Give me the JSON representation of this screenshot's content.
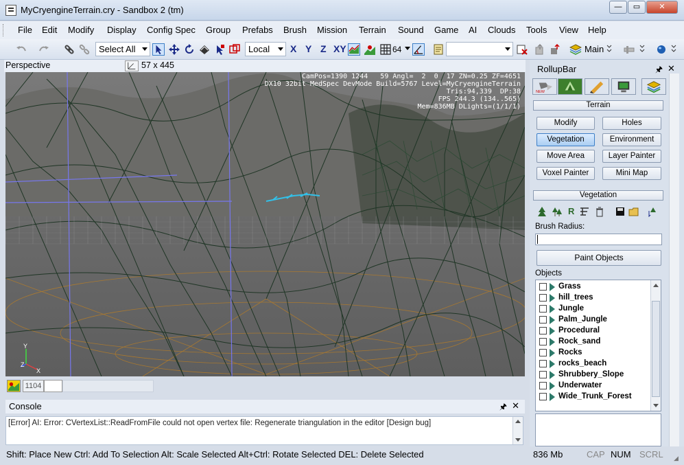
{
  "window": {
    "title": "MyCryengineTerrain.cry - Sandbox 2 (tm)",
    "min_label": "—",
    "max_label": "▭",
    "close_label": "✕"
  },
  "menu": [
    "File",
    "Edit",
    "Modify",
    "Display",
    "Config Spec",
    "Group",
    "Prefabs",
    "Brush",
    "Mission",
    "Terrain",
    "Sound",
    "Game",
    "AI",
    "Clouds",
    "Tools",
    "View",
    "Help"
  ],
  "toolbar": {
    "selection_combo": "Select All",
    "coord_combo": "Local",
    "axes": [
      "X",
      "Y",
      "Z",
      "XY"
    ],
    "grid_value": "64",
    "layout_label": "Main",
    "layer_combo": ""
  },
  "viewport": {
    "name": "Perspective",
    "size": "57 x 445",
    "overlay": [
      "CamPos=1390 1244   59 Angl=  2  0  17 ZN=0.25 ZF=4651",
      "DX10 32bit MedSpec DevMode Build=5767 Level=MyCryengineTerrain",
      "Tris:94,339  DP:38",
      "FPS 244.3 (134..565)",
      "Mem=836MB DLights=(1/1/1)"
    ],
    "axis_labels": [
      "Y",
      "Z",
      "X"
    ],
    "status_value": "1104"
  },
  "console": {
    "title": "Console",
    "message": "[Error] AI: Error: CVertexList::ReadFromFile could not open vertex file: Regenerate triangulation in the editor [Design bug]"
  },
  "statusbar": {
    "hint": "Shift: Place New  Ctrl: Add To Selection  Alt: Scale Selected  Alt+Ctrl: Rotate Selected DEL: Delete Selected",
    "memory": "836 Mb",
    "cap": "CAP",
    "num": "NUM",
    "scrl": "SCRL"
  },
  "rollup": {
    "title": "RollupBar",
    "terrain_header": "Terrain",
    "buttons": [
      "Modify",
      "Holes",
      "Vegetation",
      "Environment",
      "Move Area",
      "Layer Painter",
      "Voxel Painter",
      "Mini Map"
    ],
    "active_button": "Vegetation",
    "vegetation_header": "Vegetation",
    "brush_radius_label": "Brush Radius:",
    "brush_radius_value": "",
    "paint_button": "Paint Objects",
    "objects_label": "Objects",
    "objects": [
      "Grass",
      "hill_trees",
      "Jungle",
      "Palm_Jungle",
      "Procedural",
      "Rock_sand",
      "Rocks",
      "rocks_beach",
      "Shrubbery_Slope",
      "Underwater",
      "Wide_Trunk_Forest"
    ]
  },
  "colors": {
    "accent": "#3d7fc7",
    "terrain_wire": "#1f3525",
    "vegetation_tri": "#2d7a6a",
    "error": "#b00000"
  }
}
